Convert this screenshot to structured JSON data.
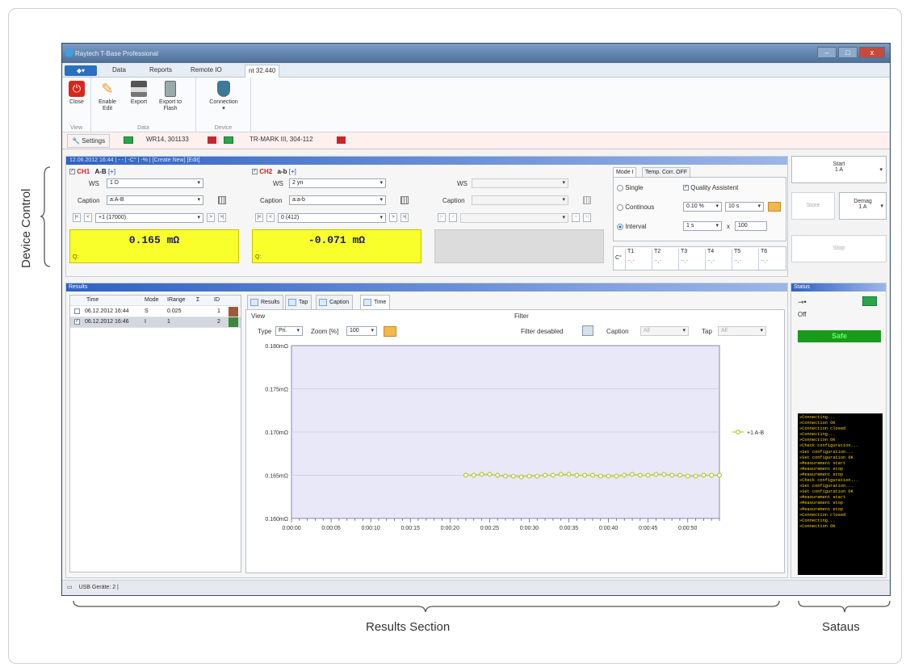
{
  "annotations": {
    "device_control": "Device Control",
    "results_section": "Results Section",
    "status": "Sataus"
  },
  "window": {
    "title": "Raytech T-Base Professional"
  },
  "menu": {
    "tabs": [
      "Data",
      "Reports",
      "Remote IO",
      "nt 32.440"
    ]
  },
  "ribbon": {
    "buttons": {
      "close": "Close",
      "enable_edit": "Enable Edit",
      "export": "Export",
      "export_flash": "Export to Flash",
      "connection": "Connection"
    },
    "groups": {
      "view": "View",
      "data": "Data",
      "device": "Device"
    }
  },
  "doc_tabs": {
    "settings": "Settings",
    "tab1": "WR14, 301133",
    "tab2": "TR-MARK III, 304-112"
  },
  "device": {
    "header": "12.06.2012 16:44 | - - | -C° | -% | [Create New] [Edit]",
    "ch1": {
      "label": "CH1",
      "name": "A-B",
      "plus": "[+]",
      "ws_label": "WS",
      "ws": "1 D",
      "caption_label": "Caption",
      "caption": "a:A-B",
      "tap": "+1 (17000)",
      "value": "0.165 mΩ",
      "q": "Q:"
    },
    "ch2": {
      "label": "CH2",
      "name": "a-b",
      "plus": "[+]",
      "ws_label": "WS",
      "ws": "2 yn",
      "caption_label": "Caption",
      "caption": "a:a-b",
      "tap": "0 (412)",
      "value": "-0.071 mΩ",
      "q": "Q:"
    },
    "ch3": {
      "ws_label": "WS",
      "caption_label": "Caption"
    },
    "mode": {
      "tab1": "Mode I",
      "tab2": "Temp. Corr. OFF",
      "single": "Single",
      "continuous": "Continous",
      "interval": "Interval",
      "quality": "Quality Assistent",
      "pct": "0.10 %",
      "secs": "10 s",
      "interval_time": "1 s",
      "x": "x",
      "count": "100"
    },
    "temps": {
      "unit": "C°",
      "labels": [
        "T1",
        "T2",
        "T3",
        "T4",
        "T5",
        "T6"
      ],
      "values": [
        "--,-",
        "--,-",
        "--,-",
        "--,-",
        "--,-",
        "--,-"
      ]
    },
    "buttons": {
      "start": "Start",
      "start_sub": "1 A",
      "store": "Store",
      "demag": "Demag",
      "demag_sub": "1 A",
      "stop": "Stop"
    }
  },
  "results": {
    "header": "Results",
    "columns": [
      "Time",
      "Mode",
      "IRange",
      "Σ",
      "ID"
    ],
    "rows": [
      {
        "time": "06.12.2012 16:44",
        "mode": "S",
        "range": "0.025",
        "id": "1",
        "checked": false,
        "color": "#a05a3a"
      },
      {
        "time": "06.12.2012 16:46",
        "mode": "I",
        "range": "1",
        "id": "2",
        "checked": true,
        "color": "#3a8a3a"
      }
    ],
    "tabs": [
      "Results",
      "Tap",
      "Caption",
      "Time"
    ],
    "view": {
      "label": "View",
      "type_label": "Type",
      "type": "Pri.",
      "zoom_label": "Zoom [%]",
      "zoom": "100"
    },
    "filter": {
      "label": "Filter",
      "status": "Filter desabled",
      "caption_label": "Caption",
      "caption": "All",
      "tap_label": "Tap",
      "tap": "All"
    }
  },
  "chart_data": {
    "type": "line",
    "y_ticks": [
      "0.180mΩ",
      "0.175mΩ",
      "0.170mΩ",
      "0.165mΩ",
      "0.160mΩ"
    ],
    "ylim": [
      0.16,
      0.18
    ],
    "x_ticks": [
      "0:00:00",
      "0:00:05",
      "0:00:10",
      "0:00:15",
      "0:00:20",
      "0:00:25",
      "0:00:30",
      "0:00:35",
      "0:00:40",
      "0:00:45",
      "0:00:50"
    ],
    "xlim": [
      0,
      54
    ],
    "series": [
      {
        "name": "+1 A-B",
        "color": "#b8c830",
        "x": [
          22,
          23,
          24,
          25,
          26,
          27,
          28,
          29,
          30,
          31,
          32,
          33,
          34,
          35,
          36,
          37,
          38,
          39,
          40,
          41,
          42,
          43,
          44,
          45,
          46,
          47,
          48,
          49,
          50,
          51,
          52,
          53,
          54
        ],
        "y": [
          0.165,
          0.165,
          0.1651,
          0.1651,
          0.165,
          0.1649,
          0.1649,
          0.1648,
          0.1649,
          0.1649,
          0.165,
          0.165,
          0.1651,
          0.1651,
          0.165,
          0.165,
          0.165,
          0.1649,
          0.1649,
          0.1649,
          0.165,
          0.1651,
          0.165,
          0.165,
          0.1651,
          0.1651,
          0.165,
          0.165,
          0.1649,
          0.1649,
          0.165,
          0.165,
          0.165
        ]
      }
    ]
  },
  "status": {
    "header": "Status",
    "off": "Off",
    "safe": "Safe",
    "log": [
      "»Connecting...",
      "»Connection OK",
      "»Connection closed",
      "»Connecting...",
      "»Connection OK",
      "»Check configuration...",
      "»Set configuration...",
      "»Set configuration OK",
      "»Measurement start",
      "»Measurement stop",
      "»Measurement stop",
      "»Check configuration...",
      "»Set configuration...",
      "»Set configuration OK",
      "»Measurement start",
      "»Measurement stop",
      "»Measurement stop",
      "»Connection closed",
      "»Connecting...",
      "»Connection OK"
    ]
  },
  "statusbar": {
    "text": "USB Geräte: 2 |"
  },
  "colors": {
    "accent": "#2f62c4",
    "display": "#f8ff2a",
    "safe": "#1a9a1a"
  }
}
